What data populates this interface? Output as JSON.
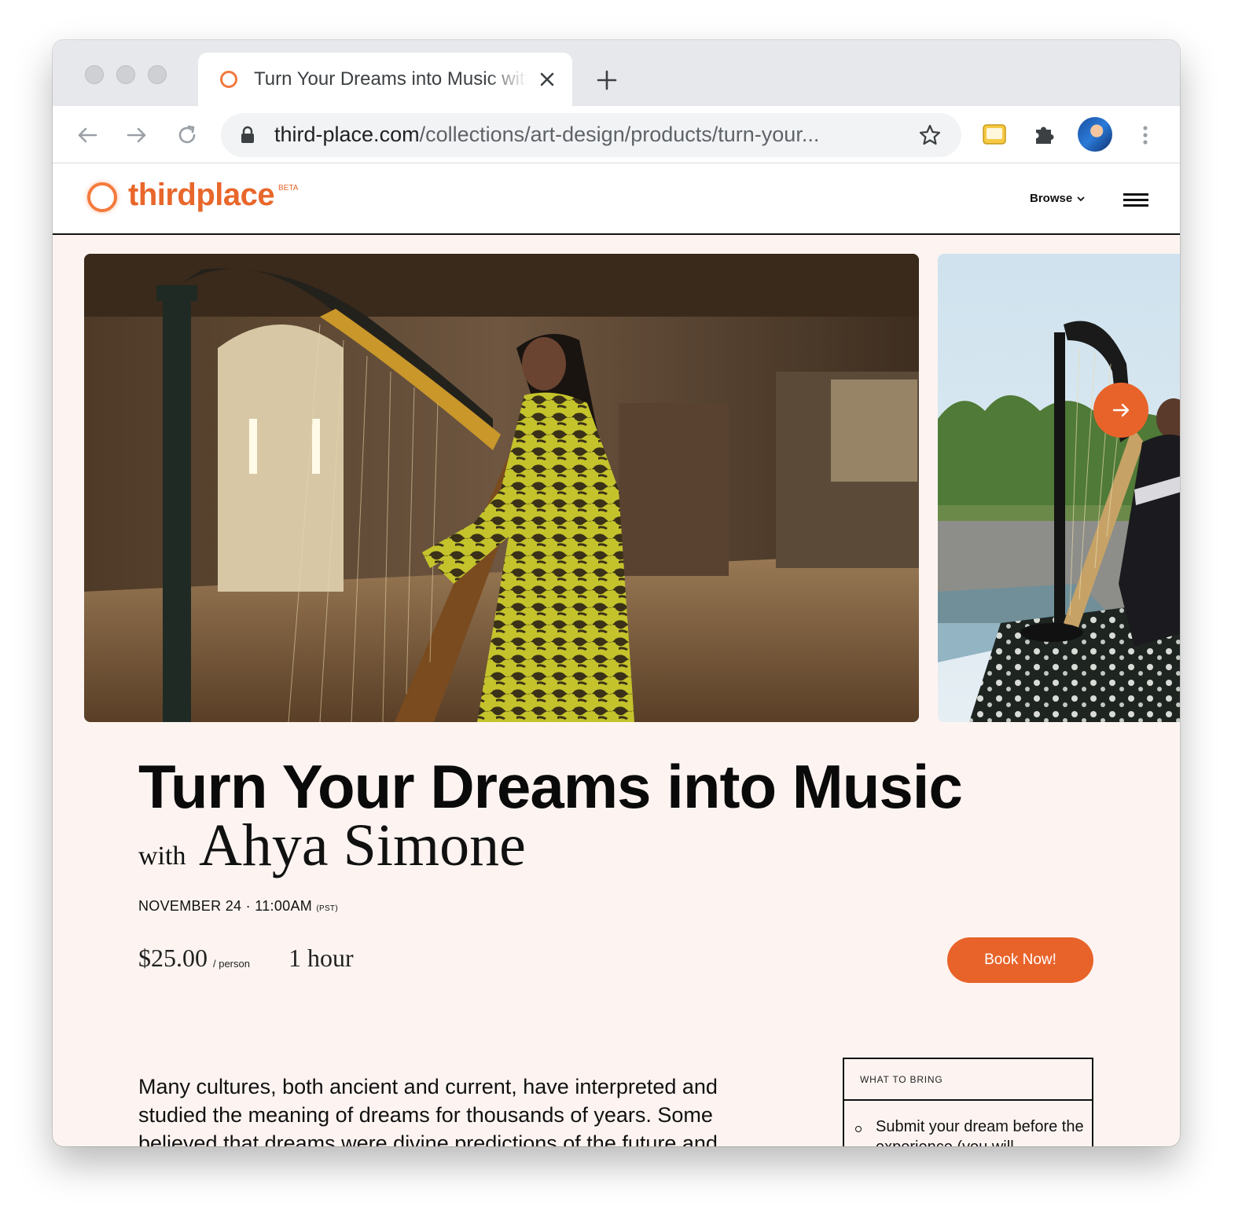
{
  "browser": {
    "tab_title": "Turn Your Dreams into Music with Ahya Simone",
    "url_host": "third-place.com",
    "url_path": "/collections/art-design/products/turn-your..."
  },
  "site": {
    "logo_text": "thirdplace",
    "beta_label": "BETA",
    "browse_label": "Browse",
    "brand_color": "#e8632a"
  },
  "product": {
    "title": "Turn Your Dreams into Music",
    "with_label": "with",
    "host": "Ahya Simone",
    "date_time": "NOVEMBER 24 · 11:00AM",
    "timezone": "(PST)",
    "price": "$25.00",
    "price_unit": "/ person",
    "duration": "1 hour",
    "book_label": "Book Now!"
  },
  "description": "Many cultures, both ancient and current, have interpreted and studied the meaning of dreams for thousands of years. Some believed that dreams were divine predictions of the future and",
  "what_to_bring": {
    "header": "WHAT TO BRING",
    "items": [
      "Submit your dream before the experience (you will"
    ]
  }
}
